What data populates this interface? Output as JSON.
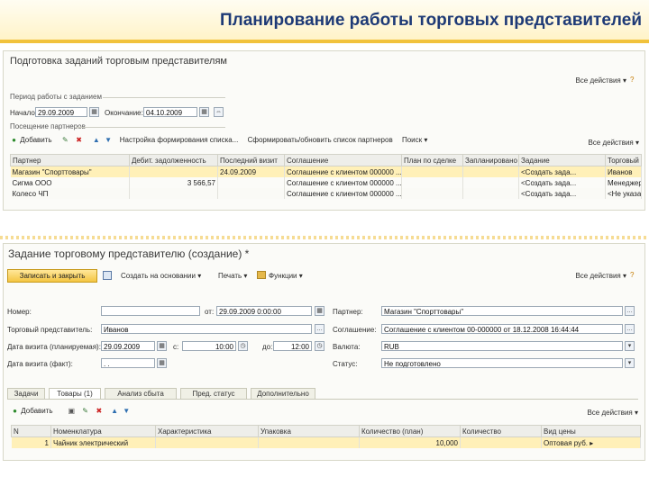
{
  "slide": {
    "title": "Планирование работы торговых представителей"
  },
  "win1": {
    "title": "Подготовка заданий торговым представителям",
    "all_actions": "Все действия ▾",
    "period_group": "Период работы с заданием",
    "start_label": "Начало:",
    "start_value": "29.09.2009",
    "end_label": "Окончание:",
    "end_value": "04.10.2009",
    "partners_group": "Посещение партнеров",
    "toolbar": {
      "add": "Добавить",
      "setup": "Настройка формирования списка...",
      "form": "Сформировать/обновить список партнеров",
      "find": "Поиск ▾",
      "all_actions": "Все действия ▾"
    },
    "columns": [
      "Партнер",
      "Дебит. задолженность",
      "Последний визит",
      "Соглашение",
      "План по сделке",
      "Запланировано",
      "Задание",
      "Торговый пр..."
    ],
    "rows": [
      [
        "Магазин \"Спорттовары\"",
        "",
        "24.09.2009",
        "Соглашение с клиентом 000000 ...",
        "",
        "",
        "<Создать зада...",
        "Иванов"
      ],
      [
        "Сигма ООО",
        "3 566,57",
        "",
        "Соглашение с клиентом 000000 ...",
        "",
        "",
        "<Создать зада...",
        "Менеджер"
      ],
      [
        "Колесо ЧП",
        "",
        "",
        "Соглашение с клиентом 000000 ...",
        "",
        "",
        "<Создать зада...",
        "<Не указан>"
      ]
    ]
  },
  "win2": {
    "title": "Задание торговому представителю (создание) *",
    "save_close": "Записать и закрыть",
    "create_basis": "Создать на основании ▾",
    "print": "Печать ▾",
    "functions": "Функции ▾",
    "all_actions": "Все действия ▾",
    "number_label": "Номер:",
    "number_value": "",
    "from_label": "от:",
    "from_value": "29.09.2009 0:00:00",
    "partner_label": "Партнер:",
    "partner_value": "Магазин \"Спорттовары\"",
    "rep_label": "Торговый представитель:",
    "rep_value": "Иванов",
    "agreement_label": "Соглашение:",
    "agreement_value": "Соглашение с клиентом 00-000000 от 18.12.2008 16:44:44",
    "visit_plan_label": "Дата визита (планируемая):",
    "visit_plan_value": "29.09.2009",
    "time_from_label": "с:",
    "time_from_value": "10:00",
    "time_to_label": "до:",
    "time_to_value": "12:00",
    "currency_label": "Валюта:",
    "currency_value": "RUB",
    "visit_fact_label": "Дата визита (факт):",
    "visit_fact_value": ". .",
    "status_label": "Статус:",
    "status_value": "Не подготовлено",
    "tabs": [
      "Задачи",
      "Товары (1)",
      "Анализ сбыта",
      "Пред. статус",
      "Дополнительно"
    ],
    "add": "Добавить",
    "all_actions2": "Все действия ▾",
    "columns": [
      "N",
      "Номенклатура",
      "Характеристика",
      "Упаковка",
      "Количество (план)",
      "Количество",
      "Вид цены"
    ],
    "rows": [
      [
        "1",
        "Чайник электрический",
        "",
        "",
        "10,000",
        "",
        "Оптовая руб. ▸"
      ]
    ]
  }
}
